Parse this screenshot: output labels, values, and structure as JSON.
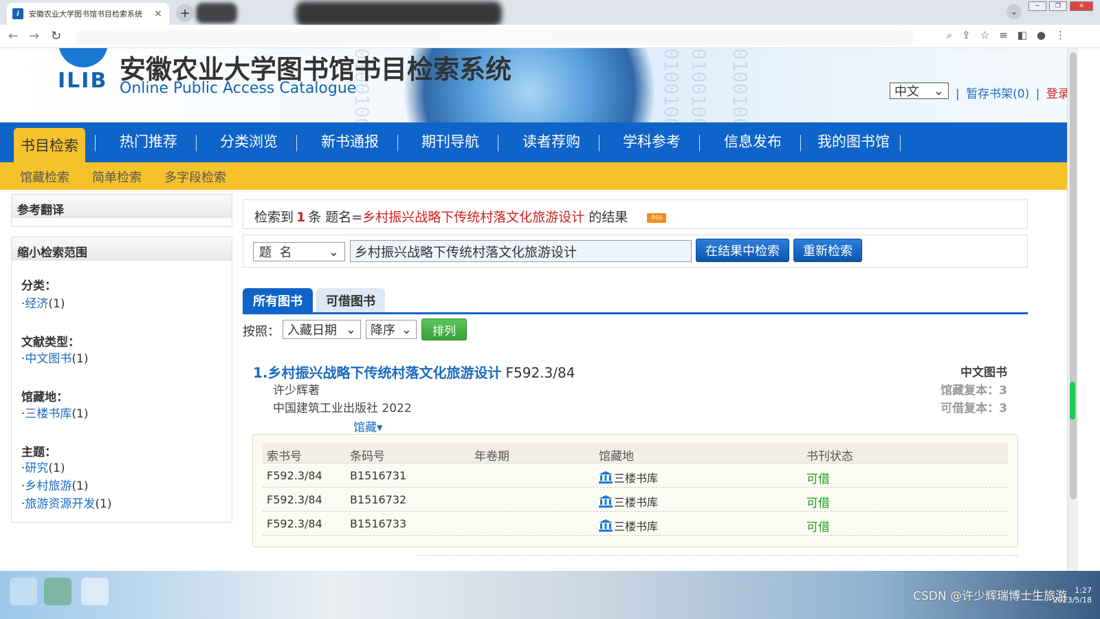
{
  "browser": {
    "tab_title": "安徽农业大学图书馆书目检索系统",
    "tab_icon": "ilib-favicon",
    "new_tab": "+",
    "tab_close": "×"
  },
  "header": {
    "logo_text": "ILIB",
    "site_title": "安徽农业大学图书馆书目检索系统",
    "site_subtitle": "Online Public Access Catalogue",
    "language": "中文",
    "shelf_link": "暂存书架(0)",
    "separator": "|",
    "login_link": "登录",
    "binary_deco": "0100100001",
    "accent_color": "#0e64c8",
    "highlight_color": "#f6c22c"
  },
  "mainnav": {
    "items": [
      "书目检索",
      "热门推荐",
      "分类浏览",
      "新书通报",
      "期刊导航",
      "读者荐购",
      "学科参考",
      "信息发布",
      "我的图书馆"
    ]
  },
  "subnav": {
    "items": [
      "馆藏检索",
      "简单检索",
      "多字段检索"
    ]
  },
  "sidebar": {
    "translate_title": "参考翻译",
    "narrow_title": "缩小检索范围",
    "facets": [
      {
        "title": "分类：",
        "items": [
          {
            "name": "经济",
            "count": "(1)"
          }
        ]
      },
      {
        "title": "文献类型：",
        "items": [
          {
            "name": "中文图书",
            "count": "(1)"
          }
        ]
      },
      {
        "title": "馆藏地：",
        "items": [
          {
            "name": "三楼书库",
            "count": "(1)"
          }
        ]
      },
      {
        "title": "主题：",
        "items": [
          {
            "name": "研究",
            "count": "(1)"
          },
          {
            "name": "乡村旅游",
            "count": "(1)"
          },
          {
            "name": "旅游资源开发",
            "count": "(1)"
          }
        ]
      }
    ],
    "bullet": "·"
  },
  "result": {
    "prefix": "检索到",
    "count": "1",
    "mid": "条 题名=",
    "query": "乡村振兴战略下传统村落文化旅游设计",
    "suffix": "的结果",
    "rss": "RSS"
  },
  "search": {
    "field": "题  名",
    "value": "乡村振兴战略下传统村落文化旅游设计",
    "btn_in_results": "在结果中检索",
    "btn_new": "重新检索"
  },
  "tabs": {
    "all": "所有图书",
    "available": "可借图书"
  },
  "sort": {
    "label": "按照：",
    "field": "入藏日期",
    "order": "降序",
    "button": "排列"
  },
  "book": {
    "index_title": "1.乡村振兴战略下传统村落文化旅游设计",
    "call_number": "F592.3/84",
    "author": "许少辉著",
    "publisher": "中国建筑工业出版社 2022",
    "holdings_link": "馆藏▾",
    "type": "中文图书",
    "copies": "馆藏复本：3",
    "available": "可借复本：3"
  },
  "holdings": {
    "headers": [
      "索书号",
      "条码号",
      "年卷期",
      "馆藏地",
      "书刊状态"
    ],
    "rows": [
      {
        "call": "F592.3/84",
        "barcode": "B1516731",
        "volume": "",
        "location": "三楼书库",
        "status": "可借"
      },
      {
        "call": "F592.3/84",
        "barcode": "B1516732",
        "volume": "",
        "location": "三楼书库",
        "status": "可借"
      },
      {
        "call": "F592.3/84",
        "barcode": "B1516733",
        "volume": "",
        "location": "三楼书库",
        "status": "可借"
      }
    ],
    "status_color": "#20a020"
  },
  "taskbar": {
    "watermark": "CSDN @许少辉瑞博士生旅游",
    "time": "1:27",
    "date": "2023/5/18"
  }
}
